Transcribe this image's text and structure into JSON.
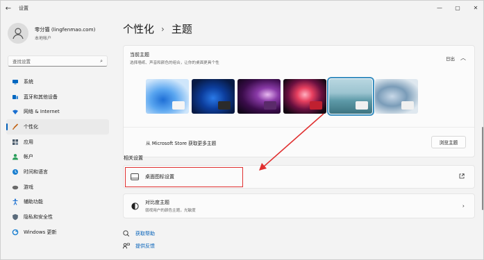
{
  "window": {
    "back_icon": "back-arrow-icon",
    "title": "设置",
    "controls": [
      "minimize",
      "maximize",
      "close"
    ]
  },
  "user": {
    "name": "零分猫 (lingfenmao.com)",
    "account_type": "本地帐户"
  },
  "search": {
    "placeholder": "查找设置"
  },
  "sidebar": {
    "items": [
      {
        "label": "系统",
        "icon": "monitor-icon",
        "color": "#0067c0"
      },
      {
        "label": "蓝牙和其他设备",
        "icon": "bluetooth-icon",
        "color": "#0067c0"
      },
      {
        "label": "网络 & Internet",
        "icon": "wifi-icon",
        "color": "#1a6fd0"
      },
      {
        "label": "个性化",
        "icon": "brush-icon",
        "color": "#c06010",
        "active": true
      },
      {
        "label": "应用",
        "icon": "apps-icon",
        "color": "#4a5a6a"
      },
      {
        "label": "帐户",
        "icon": "account-icon",
        "color": "#2a9d5a"
      },
      {
        "label": "时间和语言",
        "icon": "globe-clock-icon",
        "color": "#1a7fd0"
      },
      {
        "label": "游戏",
        "icon": "gamepad-icon",
        "color": "#6a6a6a"
      },
      {
        "label": "辅助功能",
        "icon": "accessibility-icon",
        "color": "#1a6fd0"
      },
      {
        "label": "隐私和安全性",
        "icon": "shield-icon",
        "color": "#5a6a7a"
      },
      {
        "label": "Windows 更新",
        "icon": "windows-update-icon",
        "color": "#1a7fd0"
      }
    ]
  },
  "breadcrumb": {
    "parent": "个性化",
    "current": "主题"
  },
  "current_theme": {
    "title": "当前主题",
    "description": "选择墙纸、声音和颜色的组合，让你的桌面更具个性",
    "collapse_label": "日出",
    "themes": [
      {
        "name": "windows-light",
        "selected": false
      },
      {
        "name": "windows-dark",
        "selected": false
      },
      {
        "name": "glow",
        "selected": false
      },
      {
        "name": "captured-motion",
        "selected": false
      },
      {
        "name": "sunrise",
        "selected": true
      },
      {
        "name": "flow",
        "selected": false
      }
    ],
    "store_text": "从 Microsoft Store 获取更多主题",
    "browse_button": "浏览主题"
  },
  "related": {
    "section_label": "相关设置",
    "desktop_icons": {
      "title": "桌面图标设置",
      "end_icon": "external-link-icon"
    },
    "contrast": {
      "title": "对比度主题",
      "subtitle": "弱视用户的颜色主题，光敏度",
      "end_icon": "chevron-right-icon"
    }
  },
  "links": {
    "help": "获取帮助",
    "feedback": "提供反馈"
  },
  "colors": {
    "accent": "#005fb8",
    "annotation": "#e03030"
  }
}
